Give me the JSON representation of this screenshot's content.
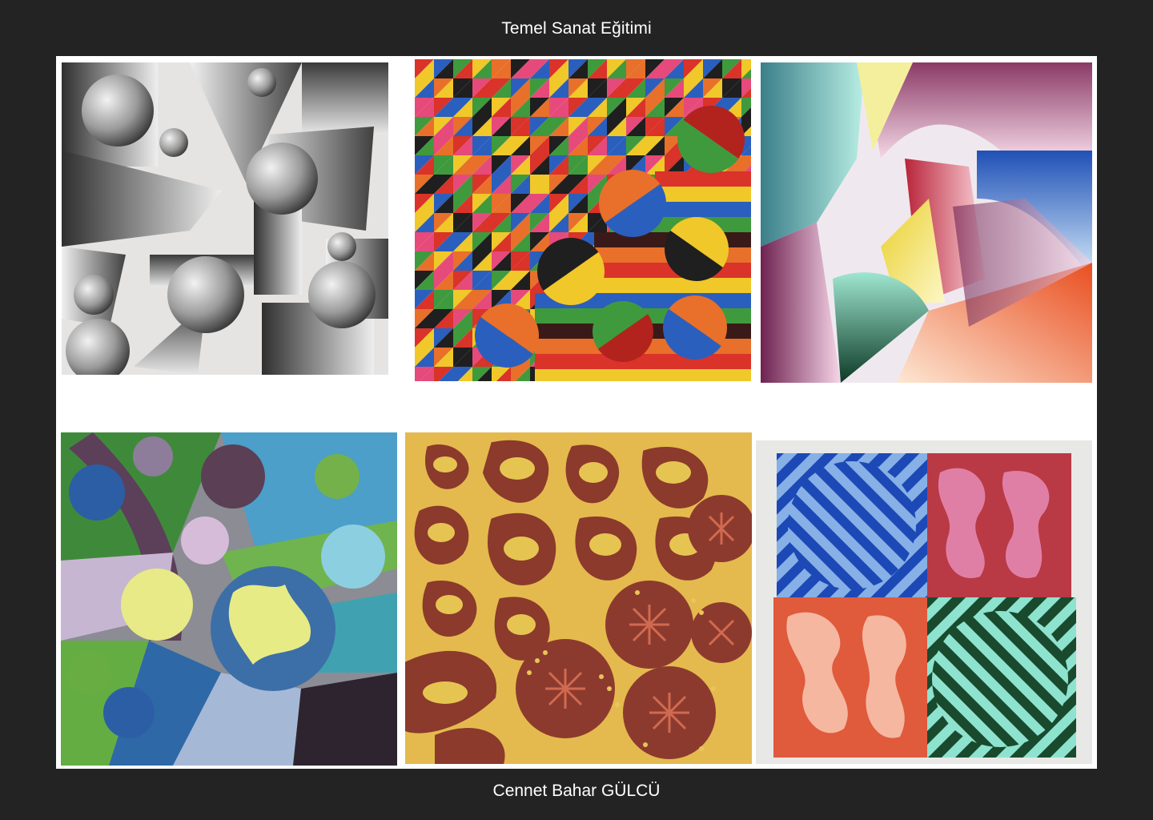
{
  "header": {
    "title": "Temel Sanat Eğitimi"
  },
  "footer": {
    "caption": "Cennet Bahar GÜLCÜ"
  },
  "gallery": {
    "artworks": [
      {
        "name": "pencil-shading-geometric-drawing"
      },
      {
        "name": "colorful-triangle-grid-painting"
      },
      {
        "name": "gradient-abstract-shapes-painting"
      },
      {
        "name": "circles-and-bands-painting"
      },
      {
        "name": "organic-shapes-painting"
      },
      {
        "name": "four-panel-pattern-painting"
      }
    ]
  },
  "palette": {
    "background": "#232323",
    "gallery_bg": "#ffffff",
    "text": "#ffffff"
  }
}
